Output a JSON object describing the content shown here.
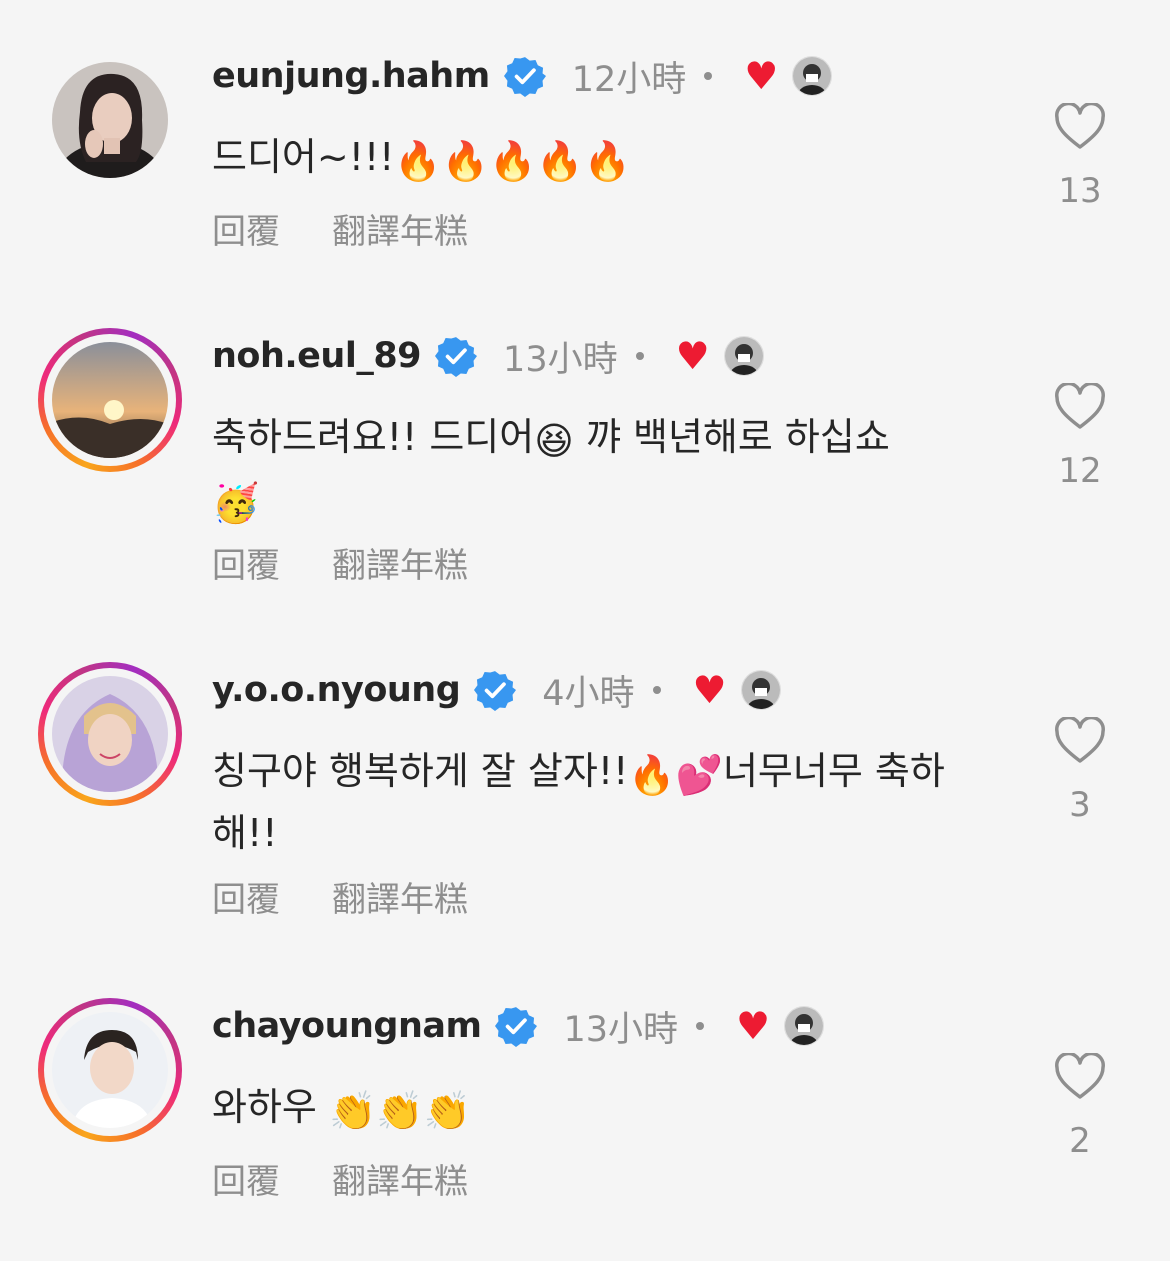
{
  "labels": {
    "reply": "回覆",
    "translate": "翻譯年糕"
  },
  "colors": {
    "verified": "#3897f0",
    "heart": "#ed1b32",
    "muted": "#8e8e8e"
  },
  "comments": [
    {
      "username": "eunjung.hahm",
      "verified": true,
      "time": "12小時",
      "text": "드디어~!!!",
      "emoji": "🔥🔥🔥🔥🔥",
      "likes": "13",
      "ring": false
    },
    {
      "username": "noh.eul_89",
      "verified": true,
      "time": "13小時",
      "text_a": "축하드려요!! 드디어",
      "emoji_a": "😆",
      "text_b": " 꺄 백년해로 하십쇼",
      "emoji_b": "🥳",
      "likes": "12",
      "ring": true
    },
    {
      "username": "y.o.o.nyoung",
      "verified": true,
      "time": "4小時",
      "text_a": "칭구야 행복하게 잘 살자!!",
      "emoji_a": "🔥💕",
      "text_b": "너무너무 축하해!!",
      "likes": "3",
      "ring": true
    },
    {
      "username": "chayoungnam",
      "verified": true,
      "time": "13小時",
      "text": "와하우 ",
      "emoji": "👏👏👏",
      "likes": "2",
      "ring": true
    }
  ]
}
